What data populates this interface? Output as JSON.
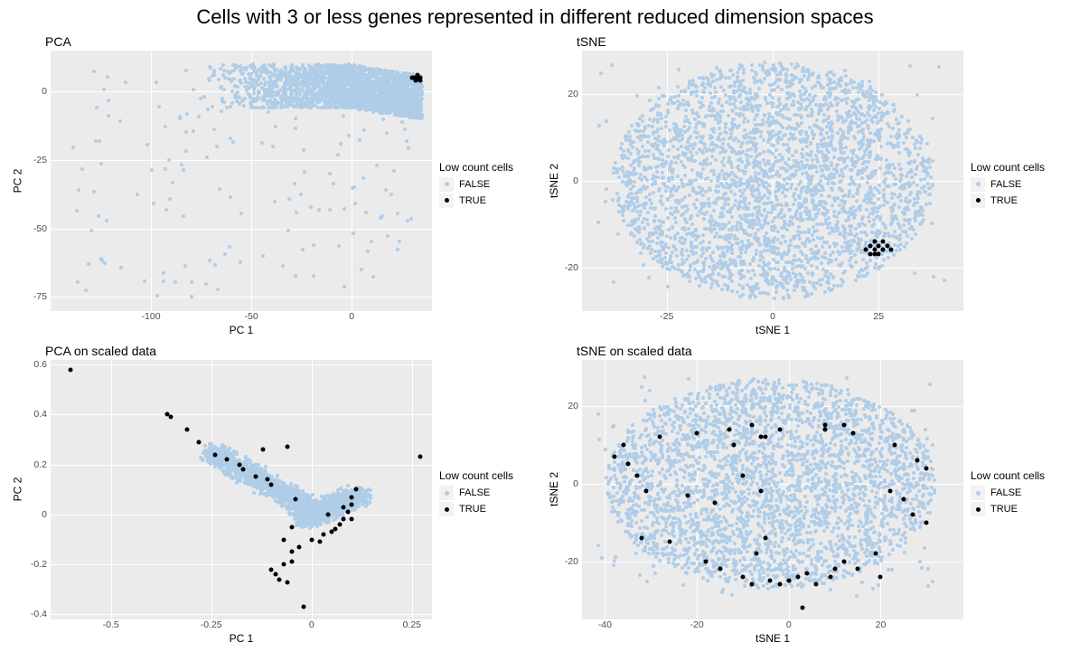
{
  "title": "Cells with 3 or less genes represented in different reduced dimension spaces",
  "legend": {
    "title": "Low count cells",
    "false_label": "FALSE",
    "true_label": "TRUE",
    "false_color": "#b0cde8",
    "true_color": "#000000"
  },
  "panels": {
    "pca": {
      "subtitle": "PCA",
      "xlabel": "PC 1",
      "ylabel": "PC 2",
      "xlim": [
        -150,
        40
      ],
      "ylim": [
        -80,
        15
      ],
      "xticks": [
        -100,
        -50,
        0
      ],
      "yticks": [
        -75,
        -50,
        -25,
        0
      ]
    },
    "tsne": {
      "subtitle": "tSNE",
      "xlabel": "tSNE 1",
      "ylabel": "tSNE 2",
      "xlim": [
        -45,
        45
      ],
      "ylim": [
        -30,
        30
      ],
      "xticks": [
        -25,
        0,
        25
      ],
      "yticks": [
        -20,
        0,
        20
      ]
    },
    "pca_scaled": {
      "subtitle": "PCA on scaled data",
      "xlabel": "PC 1",
      "ylabel": "PC 2",
      "xlim": [
        -0.65,
        0.3
      ],
      "ylim": [
        -0.42,
        0.62
      ],
      "xticks": [
        -0.5,
        -0.25,
        0.0,
        0.25
      ],
      "yticks": [
        -0.4,
        -0.2,
        0.0,
        0.2,
        0.4,
        0.6
      ]
    },
    "tsne_scaled": {
      "subtitle": "tSNE on scaled data",
      "xlabel": "tSNE 1",
      "ylabel": "tSNE 2",
      "xlim": [
        -45,
        38
      ],
      "ylim": [
        -35,
        32
      ],
      "xticks": [
        -40,
        -20,
        0,
        20
      ],
      "yticks": [
        -20,
        0,
        20
      ]
    }
  },
  "chart_data": [
    {
      "id": "pca",
      "type": "scatter",
      "title": "PCA",
      "xlabel": "PC 1",
      "ylabel": "PC 2",
      "xlim": [
        -150,
        40
      ],
      "ylim": [
        -80,
        15
      ],
      "series": [
        {
          "name": "FALSE",
          "color": "#b0cde8",
          "note": "Dense scatter cloud of thousands of cells, main mass between PC1≈-75 to 35 and PC2≈-10 to 10; sparse outliers stretching to (-145,11), (-145,-38), (-20,-78), (35,-48). Represented by procedurally generated sample points for visual reproduction.",
          "sample_points": []
        },
        {
          "name": "TRUE",
          "color": "#000000",
          "x": [
            30,
            31,
            32,
            33,
            34,
            33,
            32,
            34
          ],
          "y": [
            5,
            5,
            4,
            5,
            5,
            6,
            5,
            4
          ]
        }
      ]
    },
    {
      "id": "tsne",
      "type": "scatter",
      "title": "tSNE",
      "xlabel": "tSNE 1",
      "ylabel": "tSNE 2",
      "xlim": [
        -45,
        45
      ],
      "ylim": [
        -30,
        30
      ],
      "series": [
        {
          "name": "FALSE",
          "color": "#b0cde8",
          "note": "Large blob of thousands of points roughly covering (-40..40, -25..27) with lobes. Represented procedurally.",
          "sample_points": []
        },
        {
          "name": "TRUE",
          "color": "#000000",
          "x": [
            22,
            24,
            25,
            24,
            26,
            27,
            25,
            23,
            26,
            28,
            24,
            23
          ],
          "y": [
            -16,
            -16,
            -15,
            -17,
            -16,
            -15,
            -17,
            -15,
            -14,
            -16,
            -14,
            -17
          ]
        }
      ]
    },
    {
      "id": "pca_scaled",
      "type": "scatter",
      "title": "PCA on scaled data",
      "xlabel": "PC 1",
      "ylabel": "PC 2",
      "xlim": [
        -0.65,
        0.3
      ],
      "ylim": [
        -0.42,
        0.62
      ],
      "series": [
        {
          "name": "FALSE",
          "color": "#b0cde8",
          "note": "Dense V-shaped cloud with apex near (0,0) fanning to (-0.25,0.25) and (0.12,0.10). Represented procedurally.",
          "sample_points": []
        },
        {
          "name": "TRUE",
          "color": "#000000",
          "x": [
            -0.6,
            -0.36,
            -0.35,
            -0.31,
            -0.28,
            -0.24,
            -0.21,
            -0.18,
            -0.17,
            -0.14,
            -0.12,
            -0.11,
            -0.1,
            -0.1,
            -0.09,
            -0.08,
            -0.07,
            -0.06,
            -0.05,
            -0.05,
            -0.03,
            -0.02,
            0.0,
            0.02,
            0.03,
            0.05,
            0.06,
            0.07,
            0.08,
            0.09,
            0.1,
            0.1,
            0.11,
            0.27,
            -0.06,
            -0.04,
            -0.07,
            -0.05,
            0.04,
            0.08,
            0.1
          ],
          "y": [
            0.58,
            0.4,
            0.39,
            0.34,
            0.29,
            0.24,
            0.22,
            0.2,
            0.18,
            0.15,
            0.26,
            0.14,
            0.12,
            -0.22,
            -0.24,
            -0.26,
            -0.2,
            -0.27,
            -0.19,
            -0.15,
            -0.13,
            -0.37,
            -0.1,
            -0.11,
            -0.08,
            -0.07,
            -0.06,
            -0.04,
            -0.02,
            0.01,
            0.04,
            0.07,
            0.1,
            0.23,
            0.27,
            0.06,
            -0.1,
            -0.05,
            0.0,
            0.03,
            -0.02
          ]
        }
      ]
    },
    {
      "id": "tsne_scaled",
      "type": "scatter",
      "title": "tSNE on scaled data",
      "xlabel": "tSNE 1",
      "ylabel": "tSNE 2",
      "xlim": [
        -45,
        38
      ],
      "ylim": [
        -35,
        32
      ],
      "series": [
        {
          "name": "FALSE",
          "color": "#b0cde8",
          "note": "Large blob of thousands of points roughly covering (-42..32, -28..28). Represented procedurally.",
          "sample_points": []
        },
        {
          "name": "TRUE",
          "color": "#000000",
          "x": [
            -38,
            -36,
            -35,
            -33,
            -32,
            -31,
            -26,
            -22,
            -20,
            -18,
            -16,
            -15,
            -13,
            -12,
            -10,
            -8,
            -7,
            -6,
            -5,
            -4,
            -2,
            0,
            2,
            3,
            4,
            6,
            8,
            9,
            10,
            12,
            14,
            15,
            19,
            20,
            22,
            23,
            25,
            27,
            28,
            30,
            30,
            -28,
            -8,
            -5,
            -2,
            8,
            12,
            -10,
            -6
          ],
          "y": [
            7,
            10,
            5,
            2,
            -14,
            -2,
            -15,
            -3,
            13,
            -20,
            -5,
            -22,
            14,
            10,
            -24,
            -26,
            -18,
            12,
            -14,
            -25,
            -26,
            -25,
            -24,
            -32,
            -23,
            -26,
            14,
            -24,
            -22,
            -20,
            13,
            -22,
            -18,
            -24,
            -2,
            10,
            -4,
            -8,
            6,
            -10,
            4,
            12,
            15,
            12,
            14,
            15,
            15,
            2,
            -2
          ]
        }
      ]
    }
  ]
}
